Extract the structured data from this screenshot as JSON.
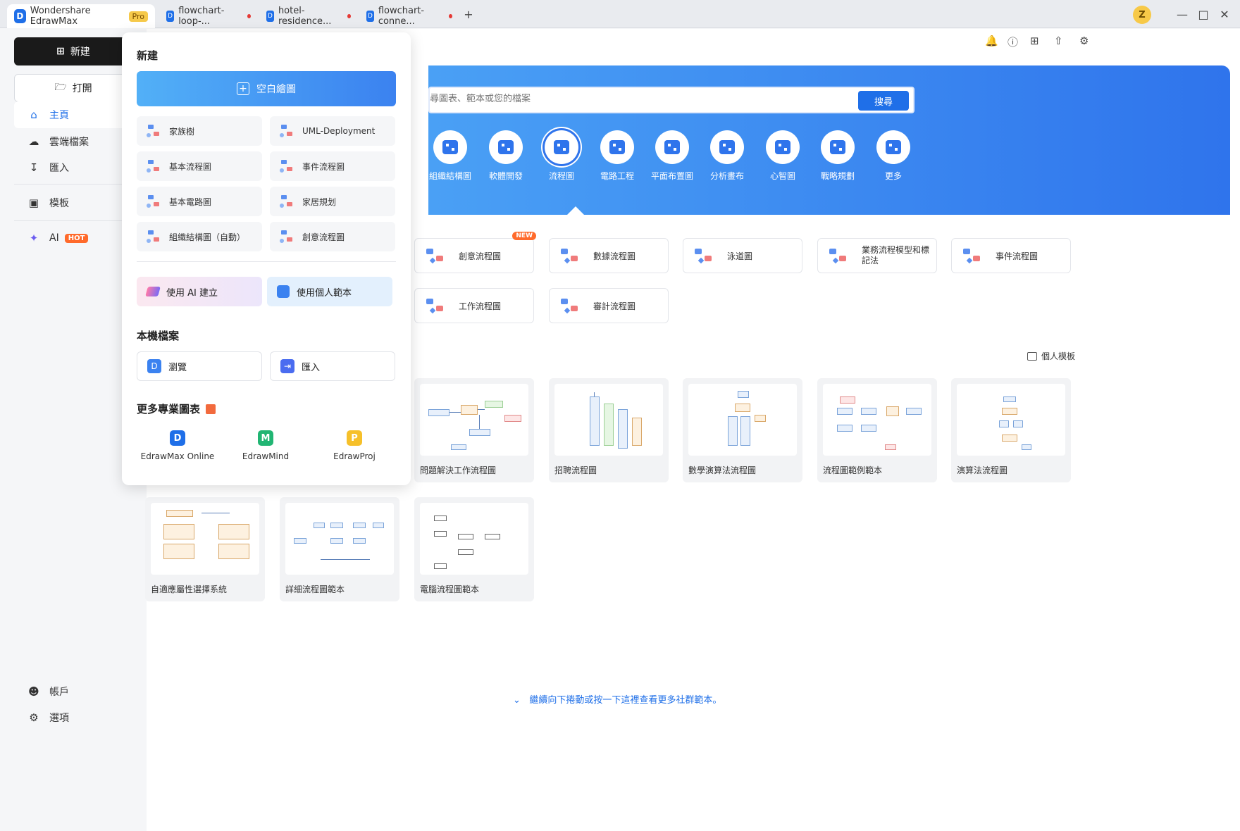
{
  "titlebar": {
    "app_title": "Wondershare EdrawMax",
    "pro_badge": "Pro",
    "tabs": [
      "flowchart-loop-...",
      "hotel-residence...",
      "flowchart-conne..."
    ],
    "new_tab": "+",
    "avatar_letter": "Z"
  },
  "sidebar": {
    "new_label": "新建",
    "open_label": "打開",
    "items": [
      "主頁",
      "雲端檔案",
      "匯入",
      "模板",
      "AI"
    ],
    "hot_badge": "HOT",
    "account": "帳戶",
    "options": "選項"
  },
  "panel": {
    "title": "新建",
    "blank_label": "空白繪圖",
    "items": [
      "家族樹",
      "UML-Deployment",
      "基本流程圖",
      "事件流程圖",
      "基本電路圖",
      "家居規划",
      "組織結構圖（自動）",
      "創意流程圖"
    ],
    "ai_create": "使用 AI 建立",
    "personal_template": "使用個人範本",
    "local_title": "本機檔案",
    "browse": "瀏覽",
    "import": "匯入",
    "more_title": "更多專業圖表",
    "products": [
      "EdrawMax Online",
      "EdrawMind",
      "EdrawProj"
    ]
  },
  "hero": {
    "search_placeholder": "尋圖表、範本或您的檔案",
    "search_button": "搜尋",
    "categories": [
      "組織結構圖",
      "軟體開發",
      "流程圖",
      "電路工程",
      "平面布置圖",
      "分析畫布",
      "心智圖",
      "戰略規劃",
      "更多"
    ],
    "selected": "流程圖"
  },
  "type_cards": [
    "創意流程圖",
    "數據流程圖",
    "泳道圖",
    "業務流程模型和標記法",
    "事件流程圖",
    "工作流程圖",
    "審計流程圖"
  ],
  "new_badge": "NEW",
  "personal_templates": "個人模板",
  "templates_row1": [
    "問題解決工作流程圖",
    "招聘流程圖",
    "數學演算法流程圖",
    "流程圖範例範本",
    "演算法流程圖"
  ],
  "templates_row2": [
    "自適應屬性選擇系統",
    "詳細流程圖範本",
    "電腦流程圖範本"
  ],
  "more_link": "繼續向下捲動或按一下這裡查看更多社群範本。"
}
